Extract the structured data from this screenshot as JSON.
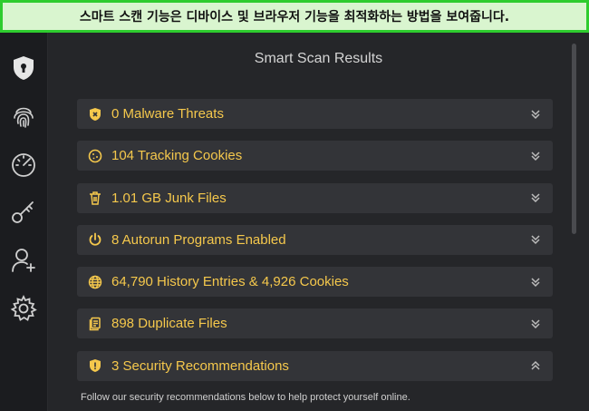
{
  "banner": {
    "text": "스마트 스캔 기능은 디바이스 및 브라우저 기능을 최적화하는 방법을 보여줍니다."
  },
  "main": {
    "title": "Smart Scan Results",
    "footnote": "Follow our security recommendations below to help protect yourself online."
  },
  "sidebar": {
    "items": [
      {
        "icon": "shield-icon"
      },
      {
        "icon": "fingerprint-icon"
      },
      {
        "icon": "speedometer-icon"
      },
      {
        "icon": "key-icon"
      },
      {
        "icon": "add-user-icon"
      },
      {
        "icon": "gear-icon"
      }
    ]
  },
  "results": [
    {
      "label": "0 Malware Threats",
      "icon": "shield-icon",
      "expanded": false
    },
    {
      "label": "104 Tracking Cookies",
      "icon": "cookie-icon",
      "expanded": false
    },
    {
      "label": "1.01 GB Junk Files",
      "icon": "trash-icon",
      "expanded": false
    },
    {
      "label": "8 Autorun Programs Enabled",
      "icon": "power-icon",
      "expanded": false
    },
    {
      "label": "64,790 History Entries & 4,926 Cookies",
      "icon": "globe-icon",
      "expanded": false
    },
    {
      "label": "898 Duplicate Files",
      "icon": "duplicate-icon",
      "expanded": false
    },
    {
      "label": "3 Security Recommendations",
      "icon": "shield-icon",
      "expanded": true
    }
  ],
  "colors": {
    "accent": "#f5c84c",
    "banner_bg": "#d9f5cf",
    "banner_border": "#2ecc2e"
  }
}
